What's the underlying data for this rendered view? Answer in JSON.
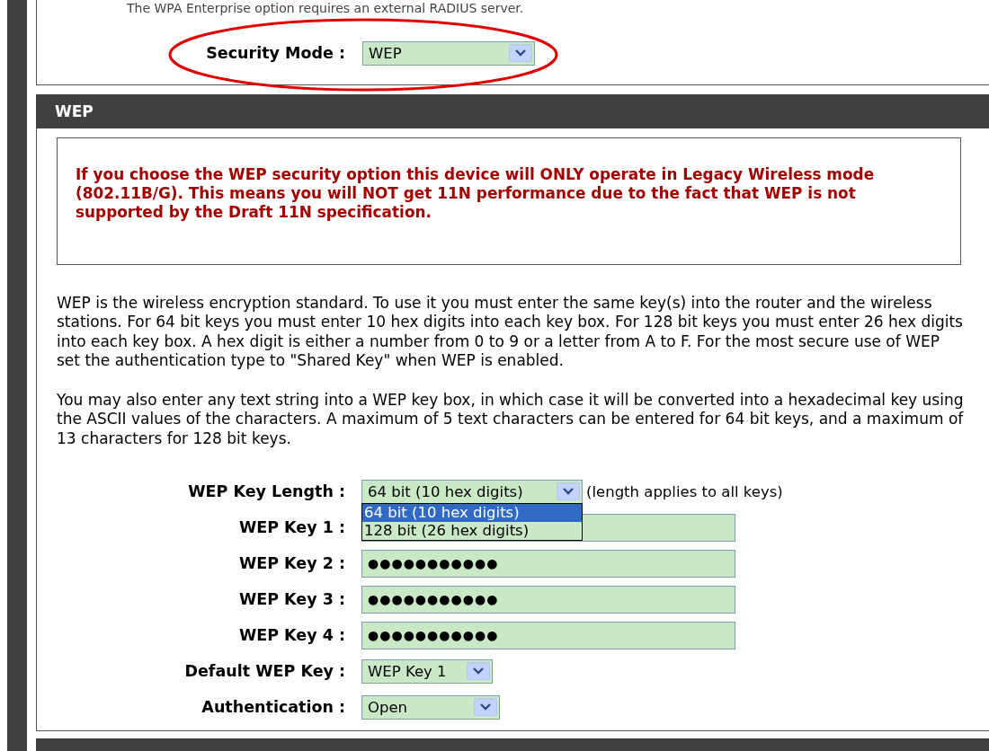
{
  "top_section": {
    "note": "The WPA Enterprise option requires an external RADIUS server.",
    "security_mode": {
      "label": "Security Mode :",
      "value": "WEP",
      "highlighted": true
    }
  },
  "wep_section": {
    "title": "WEP",
    "warning": "If you choose the WEP security option this device will ONLY operate in Legacy Wireless mode (802.11B/G). This means you will NOT get 11N performance due to the fact that WEP is not supported by the Draft 11N specification.",
    "paragraphs": [
      "WEP is the wireless encryption standard. To use it you must enter the same key(s) into the router and the wireless stations. For 64 bit keys you must enter 10 hex digits into each key box. For 128 bit keys you must enter 26 hex digits into each key box. A hex digit is either a number from 0 to 9 or a letter from A to F. For the most secure use of WEP set the authentication type to \"Shared Key\" when WEP is enabled.",
      "You may also enter any text string into a WEP key box, in which case it will be converted into a hexadecimal key using the ASCII values of the characters. A maximum of 5 text characters can be entered for 64 bit keys, and a maximum of 13 characters for 128 bit keys."
    ],
    "fields": [
      {
        "kind": "select",
        "label": "WEP Key Length :",
        "value": "64 bit (10 hex digits)",
        "note": "(length applies to all keys)",
        "options": [
          {
            "label": "64 bit (10 hex digits)",
            "selected": true
          },
          {
            "label": "128 bit (26 hex digits)",
            "selected": false
          }
        ]
      },
      {
        "kind": "key",
        "label": "WEP Key 1 :"
      },
      {
        "kind": "key",
        "label": "WEP Key 2 :",
        "value": "●●●●●●●●●●●"
      },
      {
        "kind": "key",
        "label": "WEP Key 3 :",
        "value": "●●●●●●●●●●●"
      },
      {
        "kind": "key",
        "label": "WEP Key 4 :",
        "value": "●●●●●●●●●●●"
      },
      {
        "kind": "select",
        "label": "Default WEP Key :",
        "value": "WEP Key 1"
      },
      {
        "kind": "select",
        "label": "Authentication :",
        "value": "Open"
      }
    ]
  }
}
